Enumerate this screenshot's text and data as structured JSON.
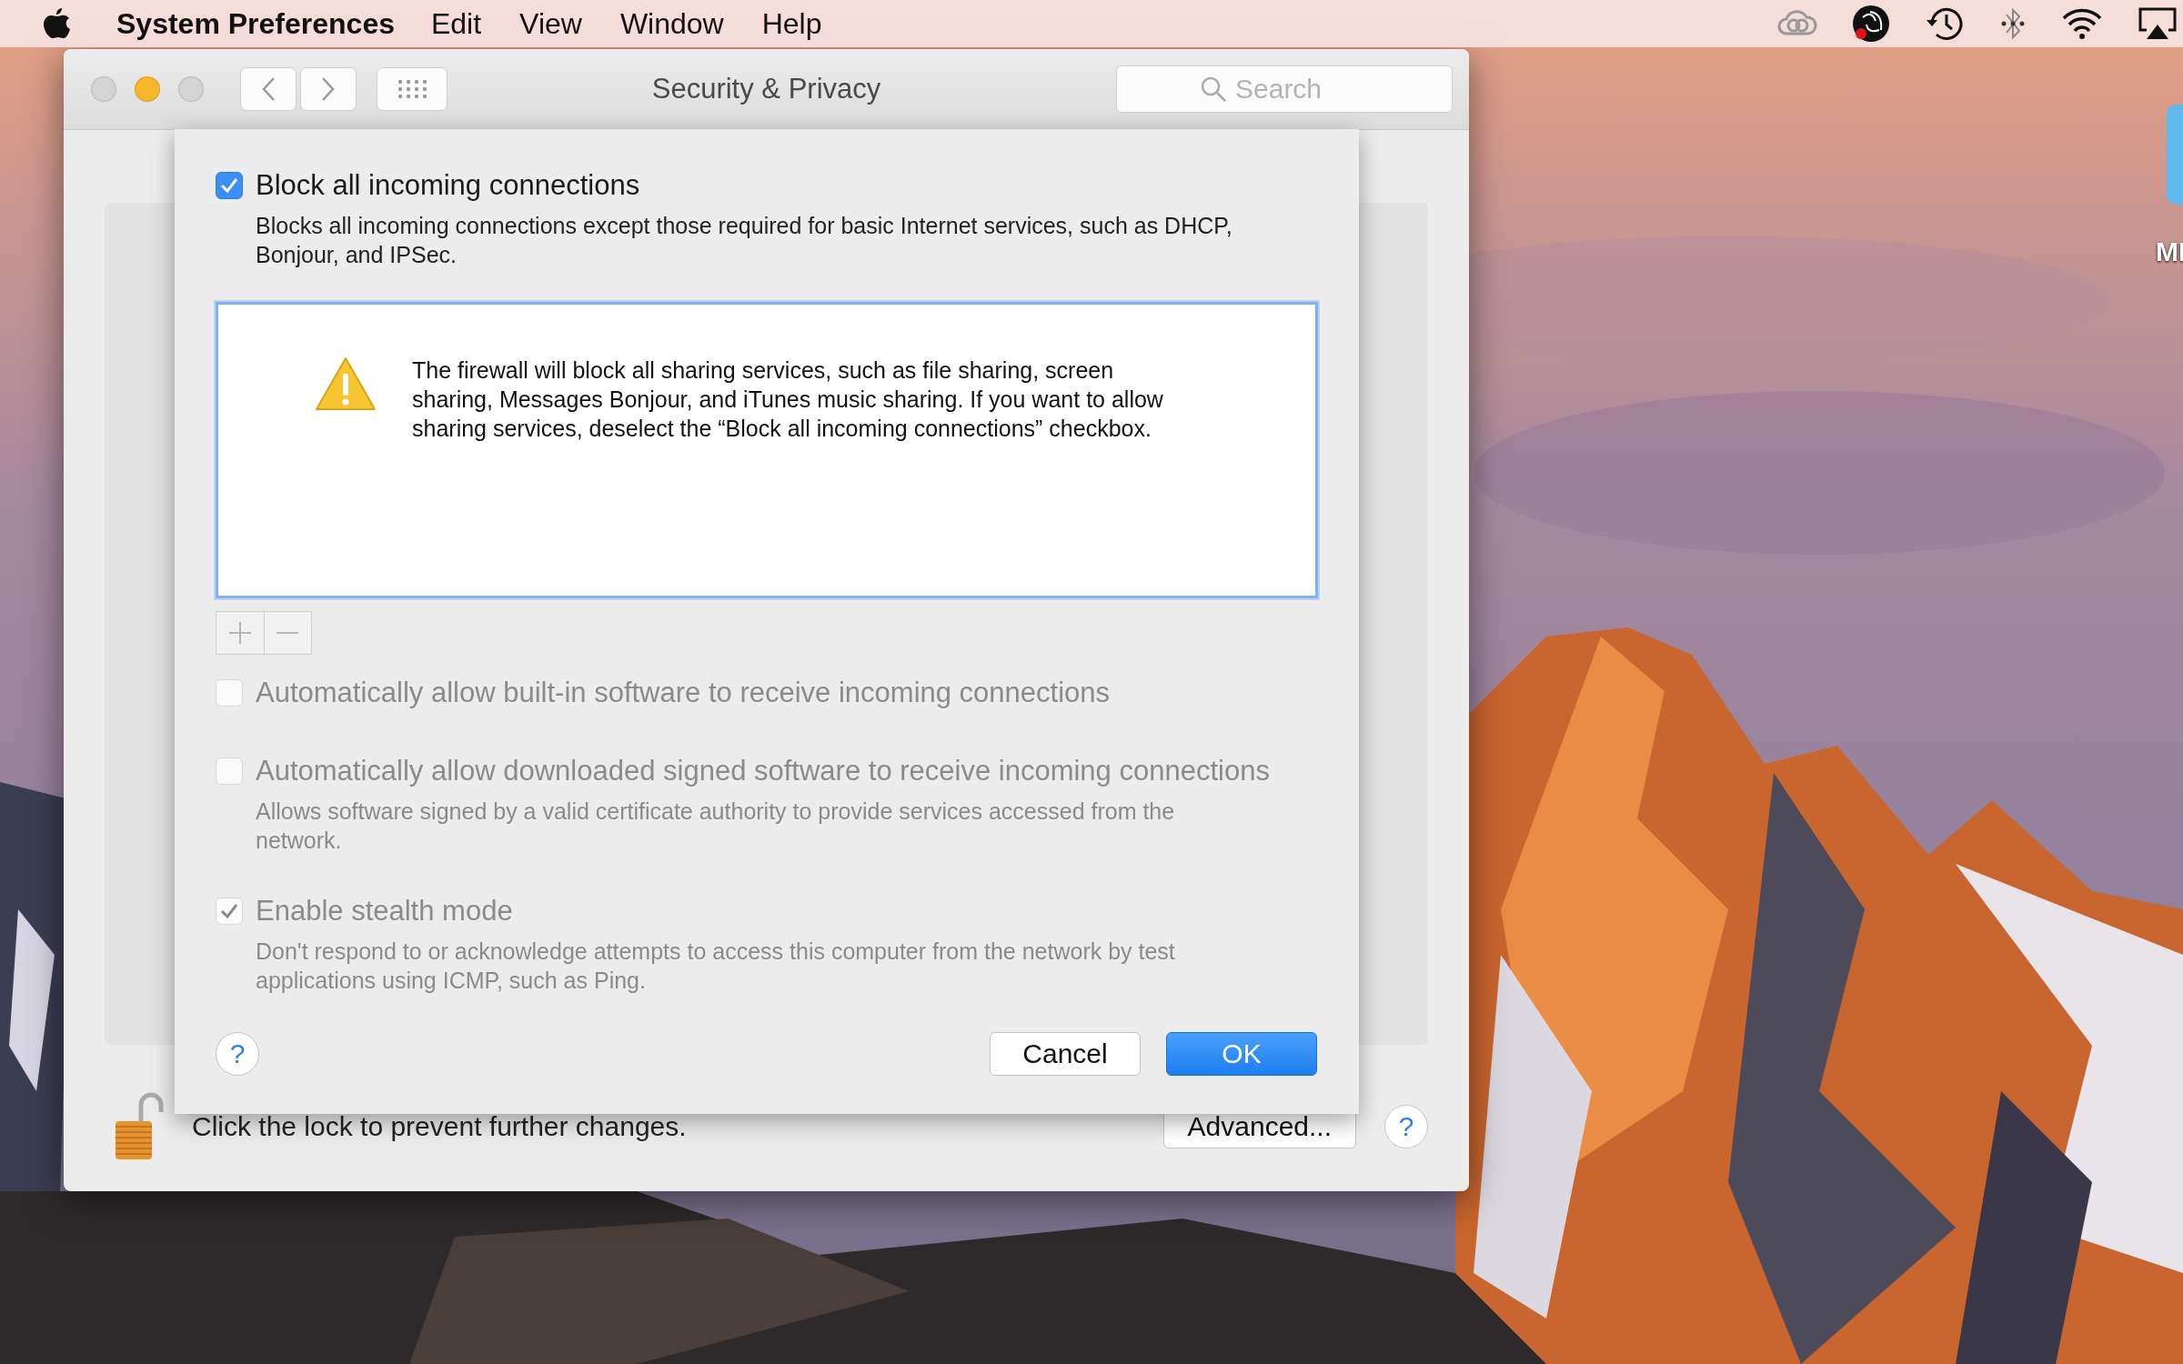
{
  "menu_bar": {
    "app_name": "System Preferences",
    "menus": [
      "Edit",
      "View",
      "Window",
      "Help"
    ]
  },
  "desktop": {
    "icon_label": "MI"
  },
  "window": {
    "title": "Security & Privacy",
    "search": {
      "placeholder": "Search"
    },
    "lock_text": "Click the lock to prevent further changes.",
    "advanced_button": "Advanced...",
    "help_button": "?"
  },
  "sheet": {
    "block_option": {
      "label": "Block all incoming connections",
      "description": "Blocks all incoming connections except those required for basic Internet services,  such as DHCP, Bonjour, and IPSec.",
      "checked": true,
      "disabled": false
    },
    "exceptions_list": {
      "warning": "The firewall will block all sharing services, such as file sharing, screen sharing, Messages Bonjour, and iTunes music sharing. If you want to allow sharing services, deselect the “Block all incoming connections” checkbox."
    },
    "options": [
      {
        "label": "Automatically allow built-in software to receive incoming connections",
        "checked": false,
        "disabled": true
      },
      {
        "label": "Automatically allow downloaded signed software to receive incoming connections",
        "description": "Allows software signed by a valid certificate authority to provide services accessed from the network.",
        "checked": false,
        "disabled": true
      },
      {
        "label": "Enable stealth mode",
        "description": "Don't respond to or acknowledge attempts to access this computer from the network by test applications using ICMP, such as Ping.",
        "checked": true,
        "disabled": true
      }
    ],
    "help_button": "?",
    "cancel_button": "Cancel",
    "ok_button": "OK"
  }
}
